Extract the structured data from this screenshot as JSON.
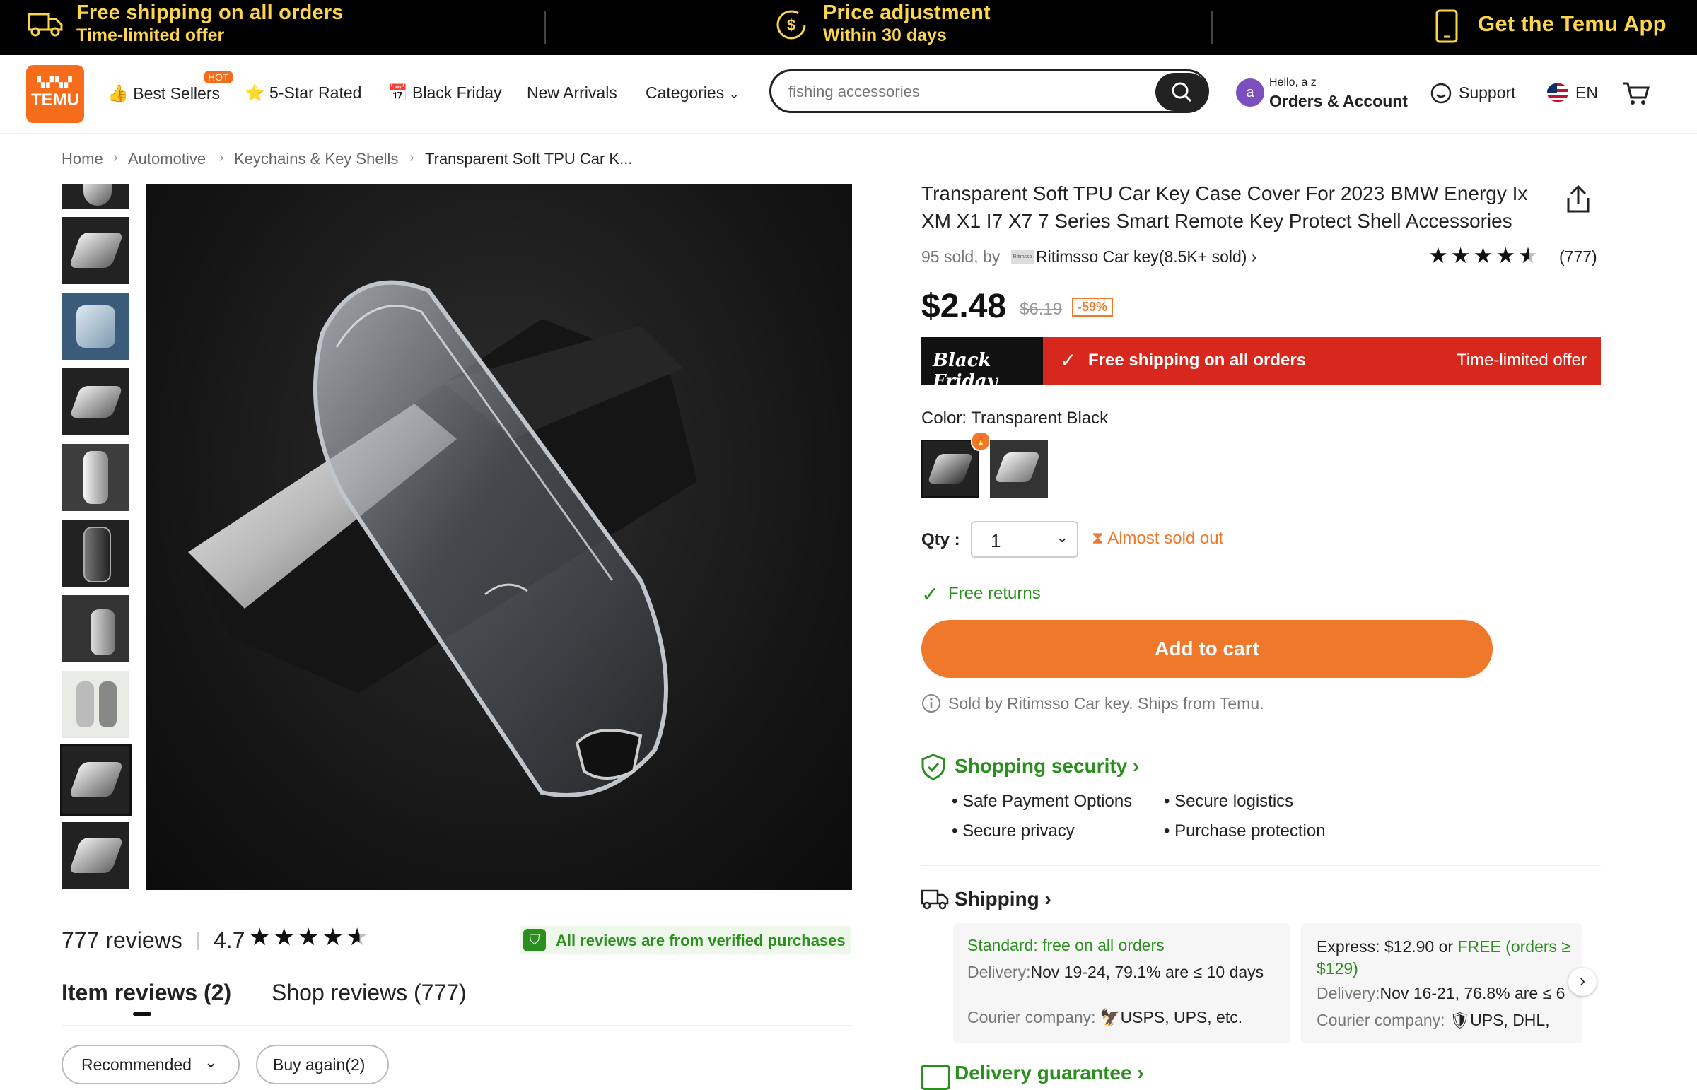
{
  "promo": {
    "shipping_title": "Free shipping on all orders",
    "shipping_sub": "Time-limited offer",
    "price_title": "Price adjustment",
    "price_sub": "Within 30 days",
    "app": "Get the Temu App"
  },
  "header": {
    "logo": "TEMU",
    "nav": [
      "Best Sellers",
      "5-Star Rated",
      "Black Friday",
      "New Arrivals",
      "Categories"
    ],
    "hot_badge": "HOT",
    "search_placeholder": "fishing accessories",
    "greeting": "Hello, a z",
    "account": "Orders & Account",
    "avatar_letter": "a",
    "support": "Support",
    "language": "EN"
  },
  "breadcrumb": [
    "Home",
    "Automotive",
    "Keychains & Key Shells",
    "Transparent Soft TPU Car K..."
  ],
  "product": {
    "title": "Transparent Soft TPU Car Key Case Cover For 2023 BMW Energy Ix XM X1 I7 X7 7 Series Smart Remote Key Protect Shell Accessories",
    "sold": "95 sold, by",
    "store_logo_text": "Ritimsso",
    "store": "Ritimsso Car key(8.5K+ sold)",
    "rating_count": "(777)",
    "rating": 4.5,
    "price": "$2.48",
    "original_price": "$6.19",
    "discount": "-59%",
    "bf_logo": "Black Friday",
    "bf_shipping": "Free shipping on all orders",
    "bf_offer": "Time-limited offer",
    "color_label": "Color: Transparent Black",
    "qty_label": "Qty :",
    "qty_value": "1",
    "stock_warning": "Almost sold out",
    "free_returns": "Free returns",
    "add_to_cart": "Add to cart",
    "sold_by": "Sold by Ritimsso Car key. Ships from Temu."
  },
  "security": {
    "title": "Shopping security",
    "items": [
      "Safe Payment Options",
      "Secure logistics",
      "Secure privacy",
      "Purchase protection"
    ]
  },
  "shipping": {
    "title": "Shipping",
    "standard_title": "Standard: free on all orders",
    "standard_delivery_label": "Delivery:",
    "standard_delivery": "Nov 19-24, 79.1% are ≤ 10 days",
    "courier_label": "Courier company:",
    "standard_couriers": "USPS,  UPS, etc.",
    "express_prefix": "Express: $12.90 or ",
    "express_free": "FREE (orders ≥ $129)",
    "express_delivery": "Nov 16-21, 76.8% are ≤ 6",
    "express_couriers": "UPS,  DHL,",
    "delivery_guarantee": "Delivery guarantee"
  },
  "reviews": {
    "count": "777 reviews",
    "rating": "4.7",
    "verified": "All reviews are from verified purchases",
    "tab_item": "Item reviews (2)",
    "tab_shop": "Shop reviews (777)",
    "sort": "Recommended",
    "filter_buy_again": "Buy again(2)"
  },
  "colors": {
    "accent_orange": "#f0782a",
    "sale_red": "#d8281e",
    "success_green": "#2a8f1d",
    "promo_yellow": "#fbd54b"
  }
}
